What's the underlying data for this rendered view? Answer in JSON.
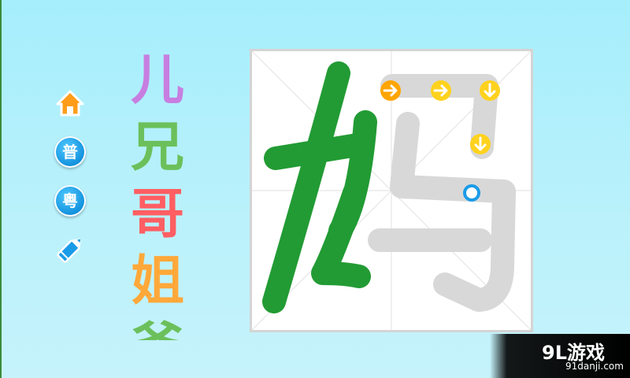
{
  "toolbar": {
    "home_icon": "home-icon",
    "mandarin_label": "普",
    "cantonese_label": "粤",
    "edit_icon": "pencil-icon"
  },
  "word_list": [
    {
      "text": "儿",
      "color": "#c77ee0"
    },
    {
      "text": "兄",
      "color": "#6cc05b"
    },
    {
      "text": "哥",
      "color": "#ff5e62"
    },
    {
      "text": "姐",
      "color": "#ffa83a"
    },
    {
      "text": "爷",
      "color": "#6cc05b"
    }
  ],
  "board": {
    "character": "妈",
    "completed_stroke_color": "#229b34",
    "pending_stroke_color": "#d8d8d8",
    "arrow_colors": {
      "start": "#ffa500",
      "next": "#ffd21e"
    },
    "cursor_color": "#1a9be8"
  },
  "watermark": {
    "logo": "9L游戏",
    "url": "91danji.com"
  }
}
